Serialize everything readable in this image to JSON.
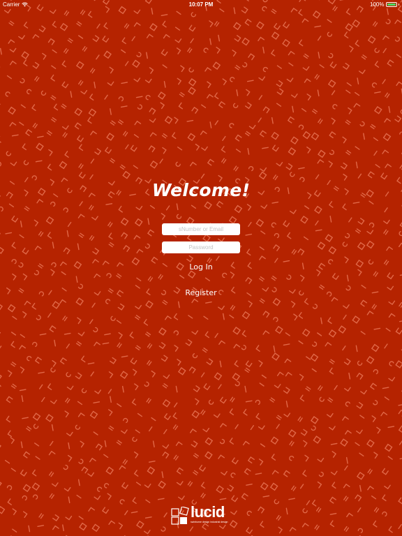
{
  "status_bar": {
    "carrier": "Carrier",
    "time": "10:07 PM",
    "battery": "100%",
    "icons": {
      "wifi": "wifi-icon",
      "battery": "battery-icon"
    },
    "battery_color": "#4cd964"
  },
  "login": {
    "title": "Welcome!",
    "email_placeholder": "sNumber or Email",
    "email_value": "",
    "password_placeholder": "Password",
    "password_value": "",
    "login_label": "Log In",
    "register_label": "Register"
  },
  "logo": {
    "name": "lucid",
    "tagline": "swinburne design industrial design",
    "icon": "lucid-logo-icon"
  },
  "colors": {
    "background": "#b52300",
    "pattern": "#e06848",
    "text": "#ffffff",
    "field_background": "#ffffff"
  }
}
